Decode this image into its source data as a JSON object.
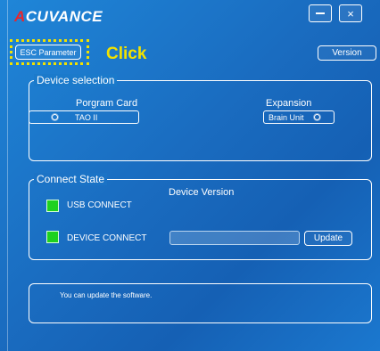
{
  "app": {
    "logo_prefix": "A",
    "logo_rest": "CUVANCE",
    "minimize_label": "—",
    "close_label": "×"
  },
  "toolbar": {
    "esc_parameter_label": "ESC Parameter",
    "annotation_text": "Click",
    "version_label": "Version"
  },
  "device_selection": {
    "title": "Device selection",
    "program_card_label": "Porgram Card",
    "program_card_value": "TAO II",
    "expansion_label": "Expansion",
    "expansion_value": "Brain Unit"
  },
  "connect_state": {
    "title": "Connect State",
    "usb_label": "USB CONNECT",
    "device_label": "DEVICE CONNECT",
    "device_version_label": "Device Version",
    "update_label": "Update",
    "usb_connected": true,
    "device_connected": true
  },
  "message": {
    "text": "You can update the software."
  },
  "colors": {
    "background": "#1a6cc0",
    "highlight": "#f2e200",
    "led_on": "#1ed11e",
    "logo_accent": "#e8262c"
  }
}
